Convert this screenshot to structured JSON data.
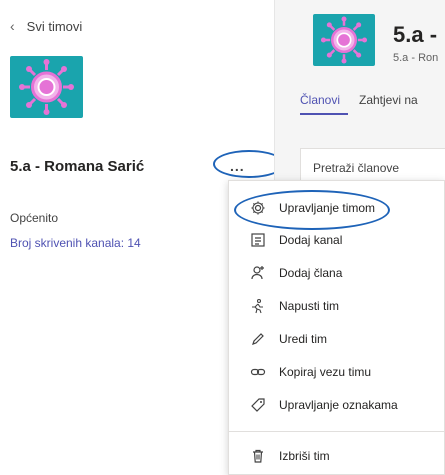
{
  "sidebar": {
    "back_label": "Svi timovi",
    "team_name": "5.a - Romana Sarić",
    "more_label": "...",
    "general_label": "Općenito",
    "hidden_channels_label": "Broj skrivenih kanala: 14"
  },
  "header": {
    "title": "5.a -",
    "subtitle": "5.a - Ron"
  },
  "tabs": [
    {
      "label": "Članovi",
      "active": true
    },
    {
      "label": "Zahtjevi na"
    }
  ],
  "search": {
    "placeholder": "Pretraži članove"
  },
  "menu": {
    "items": [
      {
        "label": "Upravljanje timom",
        "icon": "gear-icon"
      },
      {
        "label": "Dodaj kanal",
        "icon": "channel-icon"
      },
      {
        "label": "Dodaj člana",
        "icon": "add-person-icon"
      },
      {
        "label": "Napusti tim",
        "icon": "leave-icon"
      },
      {
        "label": "Uredi tim",
        "icon": "pencil-icon"
      },
      {
        "label": "Kopiraj vezu timu",
        "icon": "link-icon"
      },
      {
        "label": "Upravljanje oznakama",
        "icon": "tag-icon"
      },
      {
        "label": "Izbriši tim",
        "icon": "trash-icon"
      }
    ]
  },
  "colors": {
    "accent": "#4f52b2",
    "team_avatar_bg": "#1aa4ad",
    "team_avatar_fg": "#e573d6",
    "annotation": "#1e63b8"
  }
}
